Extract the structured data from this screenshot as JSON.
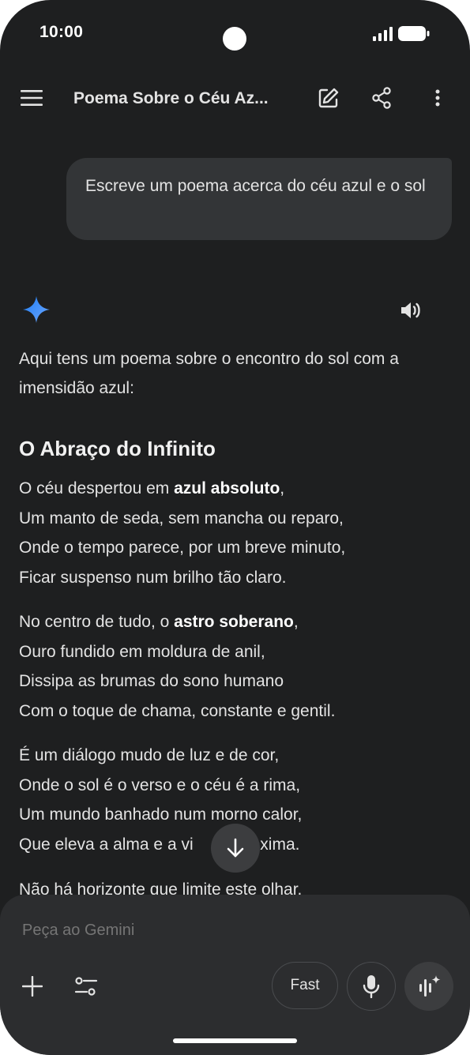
{
  "status_bar": {
    "time": "10:00"
  },
  "header": {
    "title": "Poema Sobre o Céu Az..."
  },
  "user_message": {
    "text": "Escreve um poema acerca do céu azul e o sol"
  },
  "response": {
    "intro": "Aqui tens um poema sobre o encontro do sol com a imensidão azul:",
    "poem_title": "O Abraço do Infinito",
    "stanza1": {
      "l1_pre": "O céu despertou em ",
      "l1_bold": "azul absoluto",
      "l1_post": ",",
      "l2": "Um manto de seda, sem mancha ou reparo,",
      "l3": "Onde o tempo parece, por um breve minuto,",
      "l4": "Ficar suspenso num brilho tão claro."
    },
    "stanza2": {
      "l1_pre": "No centro de tudo, o ",
      "l1_bold": "astro soberano",
      "l1_post": ",",
      "l2": "Ouro fundido em moldura de anil,",
      "l3": "Dissipa as brumas do sono humano",
      "l4": "Com o toque de chama, constante e gentil."
    },
    "stanza3": {
      "l1": "É um diálogo mudo de luz e de cor,",
      "l2": "Onde o sol é o verso e o céu é a rima,",
      "l3": "Um mundo banhado num morno calor,",
      "l4_pre": "Que eleva a alma e a vi",
      "l4_post": "roxima."
    },
    "partial_line": "Não há horizonte que limite este olhar."
  },
  "composer": {
    "placeholder": "Peça ao Gemini",
    "mode_label": "Fast"
  },
  "icons": {
    "menu": "menu-icon",
    "edit": "edit-icon",
    "share": "share-icon",
    "more": "more-vert-icon",
    "gemini": "gemini-sparkle-icon",
    "speaker": "speaker-icon",
    "scroll_down": "arrow-down-icon",
    "add": "plus-icon",
    "tools": "tune-icon",
    "mic": "mic-icon",
    "live": "live-waveform-icon"
  },
  "colors": {
    "background": "#1e1f20",
    "bubble": "#333537",
    "composer": "#2c2d2f",
    "gemini_blue": "#4285f4"
  }
}
